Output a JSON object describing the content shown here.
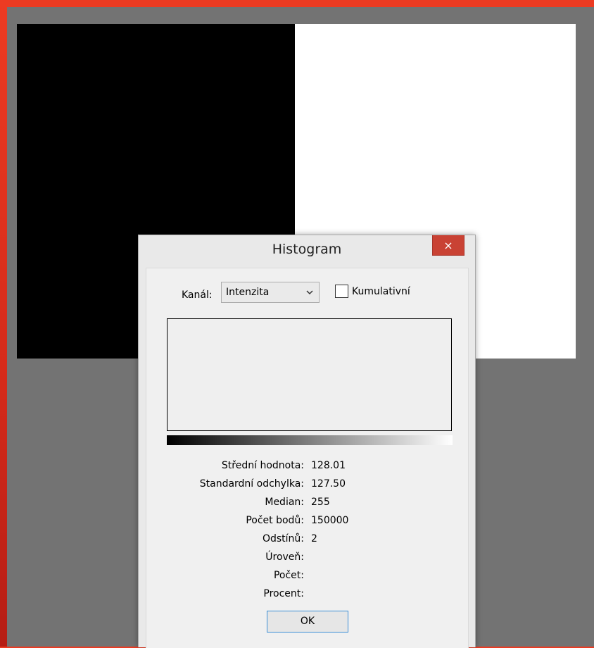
{
  "dialog": {
    "title": "Histogram",
    "close_symbol": "×",
    "channel_label": "Kanál:",
    "channel_value": "Intenzita",
    "cumulative_label": "Kumulativní",
    "cumulative_checked": false,
    "stats": [
      {
        "label": "Střední hodnota:",
        "value": "128.01"
      },
      {
        "label": "Standardní odchylka:",
        "value": "127.50"
      },
      {
        "label": "Median:",
        "value": "255"
      },
      {
        "label": "Počet bodů:",
        "value": "150000"
      },
      {
        "label": "Odstínů:",
        "value": "2"
      },
      {
        "label": "Úroveň:",
        "value": ""
      },
      {
        "label": "Počet:",
        "value": ""
      },
      {
        "label": "Procent:",
        "value": ""
      }
    ],
    "ok_label": "OK"
  },
  "colors": {
    "window_frame": "#ec3b22",
    "workspace_bg": "#737373",
    "close_button": "#c94234",
    "ok_border": "#3c8fd6"
  },
  "icons": {
    "close": "close-icon",
    "dropdown": "chevron-down-icon"
  }
}
